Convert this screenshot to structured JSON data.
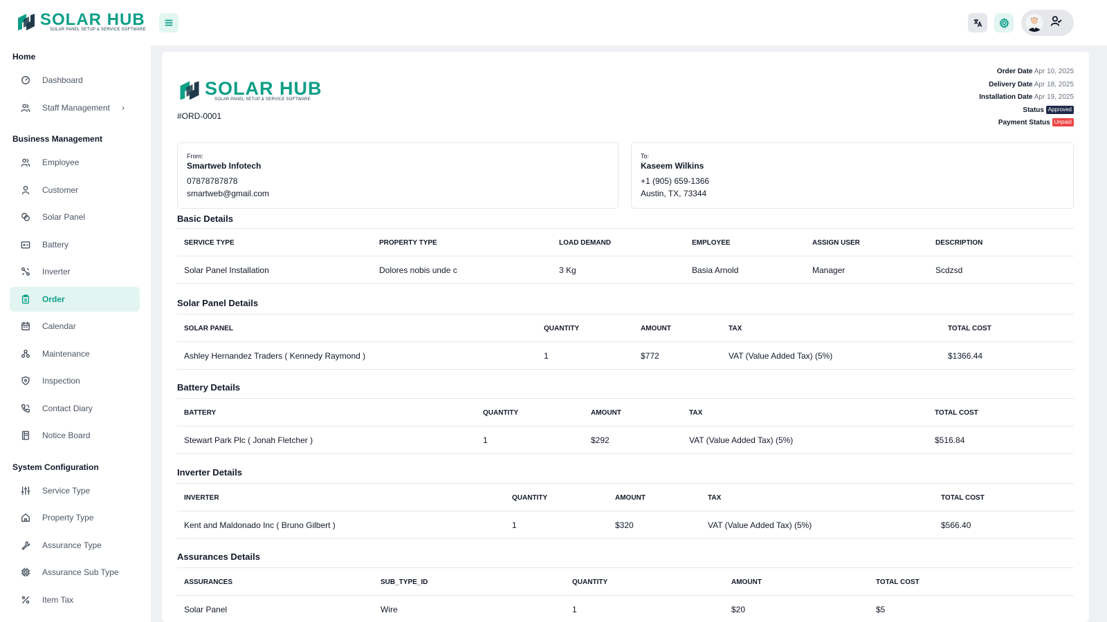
{
  "brand": {
    "name": "SOLAR HUB",
    "tagline": "SOLAR PANEL SETUP & SERVICE SOFTWARE",
    "accent": "#0e9f87"
  },
  "sidebar": {
    "sections": [
      {
        "title": "Home",
        "items": [
          {
            "label": "Dashboard",
            "icon": "dashboard-icon"
          },
          {
            "label": "Staff Management",
            "icon": "users-icon",
            "has_submenu": true
          }
        ]
      },
      {
        "title": "Business Management",
        "items": [
          {
            "label": "Employee",
            "icon": "users-icon"
          },
          {
            "label": "Customer",
            "icon": "user-icon"
          },
          {
            "label": "Solar Panel",
            "icon": "solar-panel-icon"
          },
          {
            "label": "Battery",
            "icon": "battery-icon"
          },
          {
            "label": "Inverter",
            "icon": "inverter-icon"
          },
          {
            "label": "Order",
            "icon": "clipboard-icon",
            "active": true
          },
          {
            "label": "Calendar",
            "icon": "calendar-icon"
          },
          {
            "label": "Maintenance",
            "icon": "maintenance-icon"
          },
          {
            "label": "Inspection",
            "icon": "shield-icon"
          },
          {
            "label": "Contact Diary",
            "icon": "phone-icon"
          },
          {
            "label": "Notice Board",
            "icon": "notice-icon"
          }
        ]
      },
      {
        "title": "System Configuration",
        "items": [
          {
            "label": "Service Type",
            "icon": "sliders-icon"
          },
          {
            "label": "Property Type",
            "icon": "home-icon"
          },
          {
            "label": "Assurance Type",
            "icon": "wrench-icon"
          },
          {
            "label": "Assurance Sub Type",
            "icon": "chip-icon"
          },
          {
            "label": "Item Tax",
            "icon": "percent-icon"
          }
        ]
      }
    ]
  },
  "topbar": {
    "translate_icon": "translate-icon",
    "settings_icon": "gear-icon",
    "profile_icon": "user-check-icon"
  },
  "order": {
    "id": "#ORD-0001",
    "meta": {
      "order_date_label": "Order Date",
      "order_date": "Apr 10, 2025",
      "delivery_date_label": "Delivery Date",
      "delivery_date": "Apr 18, 2025",
      "installation_date_label": "Installation Date",
      "installation_date": "Apr 19, 2025",
      "status_label": "Status",
      "status": "Approved",
      "payment_status_label": "Payment Status",
      "payment_status": "Unpaid"
    },
    "from": {
      "label": "From:",
      "name": "Smartweb Infotech",
      "phone": "07878787878",
      "email": "smartweb@gmail.com"
    },
    "to": {
      "label": "To:",
      "name": "Kaseem Wilkins",
      "phone": "+1 (905) 659-1366",
      "address": "Austin, TX, 73344"
    }
  },
  "sections": {
    "basic": {
      "title": "Basic Details",
      "headers": [
        "SERVICE TYPE",
        "PROPERTY TYPE",
        "LOAD DEMAND",
        "EMPLOYEE",
        "ASSIGN USER",
        "DESCRIPTION"
      ],
      "rows": [
        [
          "Solar Panel Installation",
          "Dolores nobis unde c",
          "3 Kg",
          "Basia Arnold",
          "Manager",
          "Scdzsd"
        ]
      ]
    },
    "solar": {
      "title": "Solar Panel Details",
      "headers": [
        "SOLAR PANEL",
        "QUANTITY",
        "AMOUNT",
        "TAX",
        "TOTAL COST"
      ],
      "rows": [
        [
          "Ashley Hernandez Traders ( Kennedy Raymond )",
          "1",
          "$772",
          "VAT (Value Added Tax) (5%)",
          "$1366.44"
        ]
      ]
    },
    "battery": {
      "title": "Battery Details",
      "headers": [
        "BATTERY",
        "QUANTITY",
        "AMOUNT",
        "TAX",
        "TOTAL COST"
      ],
      "rows": [
        [
          "Stewart Park Plc ( Jonah Fletcher )",
          "1",
          "$292",
          "VAT (Value Added Tax) (5%)",
          "$516.84"
        ]
      ]
    },
    "inverter": {
      "title": "Inverter Details",
      "headers": [
        "INVERTER",
        "QUANTITY",
        "AMOUNT",
        "TAX",
        "TOTAL COST"
      ],
      "rows": [
        [
          "Kent and Maldonado Inc ( Bruno Gilbert )",
          "1",
          "$320",
          "VAT (Value Added Tax) (5%)",
          "$566.40"
        ]
      ]
    },
    "assurances": {
      "title": "Assurances Details",
      "headers": [
        "ASSURANCES",
        "SUB_TYPE_ID",
        "QUANTITY",
        "AMOUNT",
        "TOTAL COST"
      ],
      "rows": [
        [
          "Solar Panel",
          "Wire",
          "1",
          "$20",
          "$5"
        ]
      ]
    }
  }
}
